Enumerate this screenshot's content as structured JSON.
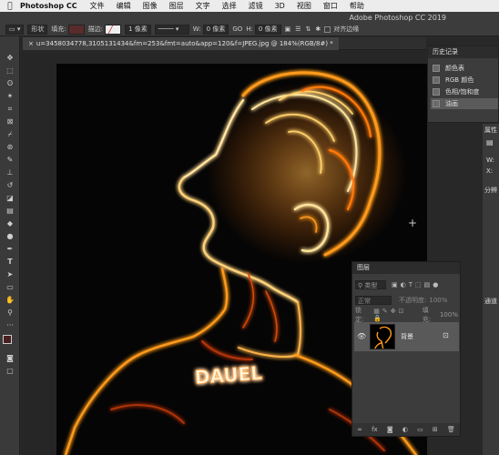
{
  "menubar": {
    "app_name": "Photoshop CC",
    "items": [
      "文件",
      "编辑",
      "图像",
      "图层",
      "文字",
      "选择",
      "滤镜",
      "3D",
      "视图",
      "窗口",
      "帮助"
    ]
  },
  "window_title": "Adobe Photoshop CC 2019",
  "options": {
    "shape_mode": "形状",
    "fill_label": "填充:",
    "stroke_label": "描边:",
    "stroke_width": "1 像素",
    "w_label": "W:",
    "w_value": "0 像素",
    "go_label": "GO",
    "h_label": "H:",
    "h_value": "0 像素",
    "align_edges": "对齐边缘"
  },
  "document_tab": "u=3458034778,3105131434&fm=253&fmt=auto&app=120&f=JPEG.jpg @ 184%(RGB/8#) *",
  "history": {
    "title": "历史记录",
    "items": [
      "颜色表",
      "RGB 颜色",
      "色相/饱和度",
      "油画"
    ],
    "selected_index": 3
  },
  "properties": {
    "tab_label": "属性",
    "w_label": "W:",
    "x_label": "X:",
    "section_label": "分辨"
  },
  "layers": {
    "title": "图层",
    "kind_filter": "类型",
    "blend_mode": "正常",
    "opacity_label": "不透明度:",
    "opacity_value": "100%",
    "lock_label": "锁定:",
    "fill_label": "填充:",
    "fill_value": "100%",
    "layer_name": "背景"
  },
  "artwork_text": "DAUEL",
  "right_strip_label": "通道",
  "colors": {
    "neon_hot": "#ffe39a",
    "neon_mid": "#ff9a1f",
    "neon_dark": "#b3360a",
    "canvas_bg": "#050505",
    "panel_bg": "#3c3c3c"
  }
}
